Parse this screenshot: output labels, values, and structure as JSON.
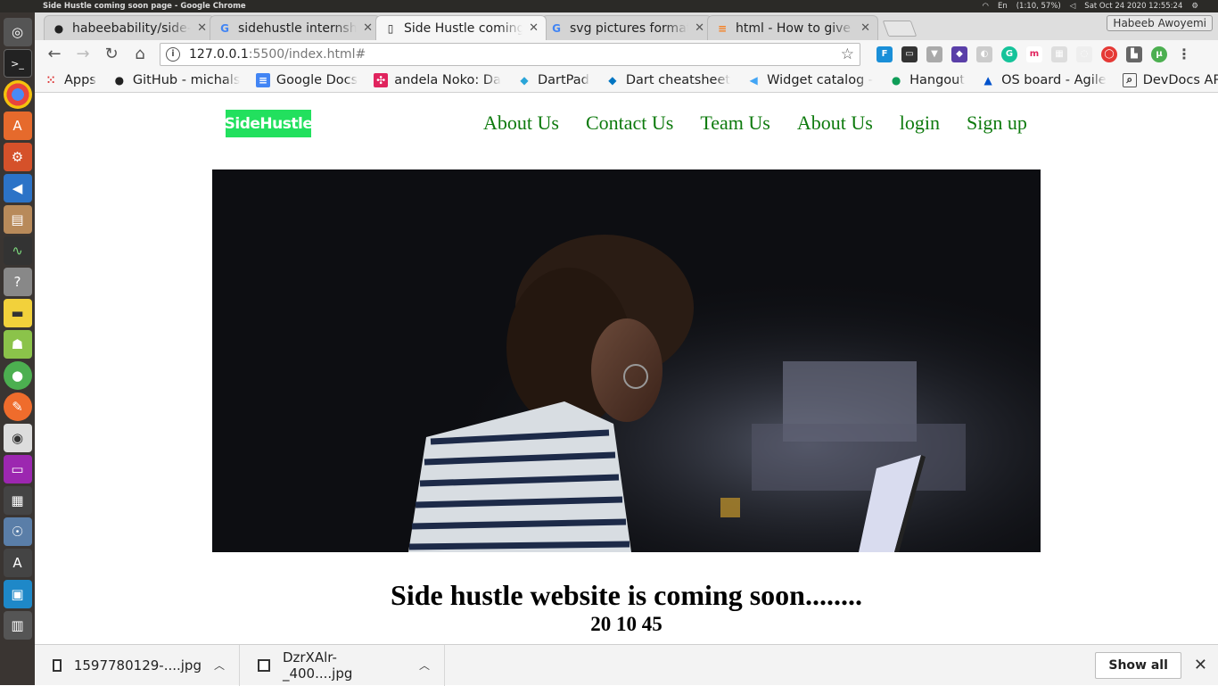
{
  "os": {
    "window_title": "Side Hustle coming soon page - Google Chrome",
    "language": "En",
    "battery": "(1:10, 57%)",
    "datetime": "Sat Oct 24 2020 12:55:24",
    "user": "Habeeb Awoyemi"
  },
  "tabs": [
    {
      "title": "habeebability/side-",
      "icon": "github-icon"
    },
    {
      "title": "sidehustle internsh",
      "icon": "google-icon"
    },
    {
      "title": "Side Hustle coming",
      "icon": "page-icon"
    },
    {
      "title": "svg pictures format",
      "icon": "google-icon"
    },
    {
      "title": "html - How to give t",
      "icon": "stackoverflow-icon"
    }
  ],
  "address": {
    "host": "127.0.0.1",
    "rest": ":5500/index.html#"
  },
  "bookmarks": [
    {
      "label": "Apps"
    },
    {
      "label": "GitHub - michals"
    },
    {
      "label": "Google Docs"
    },
    {
      "label": "andela Noko: Da"
    },
    {
      "label": "DartPad"
    },
    {
      "label": "Dart cheatsheet"
    },
    {
      "label": "Widget catalog -"
    },
    {
      "label": "Hangout"
    },
    {
      "label": "OS board - Agile"
    },
    {
      "label": "DevDocs API Do"
    }
  ],
  "site": {
    "logo": "SideHustle",
    "nav": [
      "About Us",
      "Contact Us",
      "Team Us",
      "About Us",
      "login",
      "Sign up"
    ],
    "headline": "Side hustle website is coming soon........",
    "countdown": "20 10 45"
  },
  "downloads": {
    "items": [
      "1597780129-....jpg",
      "DzrXAlr-_400....jpg"
    ],
    "show_all": "Show all"
  },
  "colors": {
    "nav_link": "#0d7a0d",
    "logo_bg": "#22e05e"
  }
}
